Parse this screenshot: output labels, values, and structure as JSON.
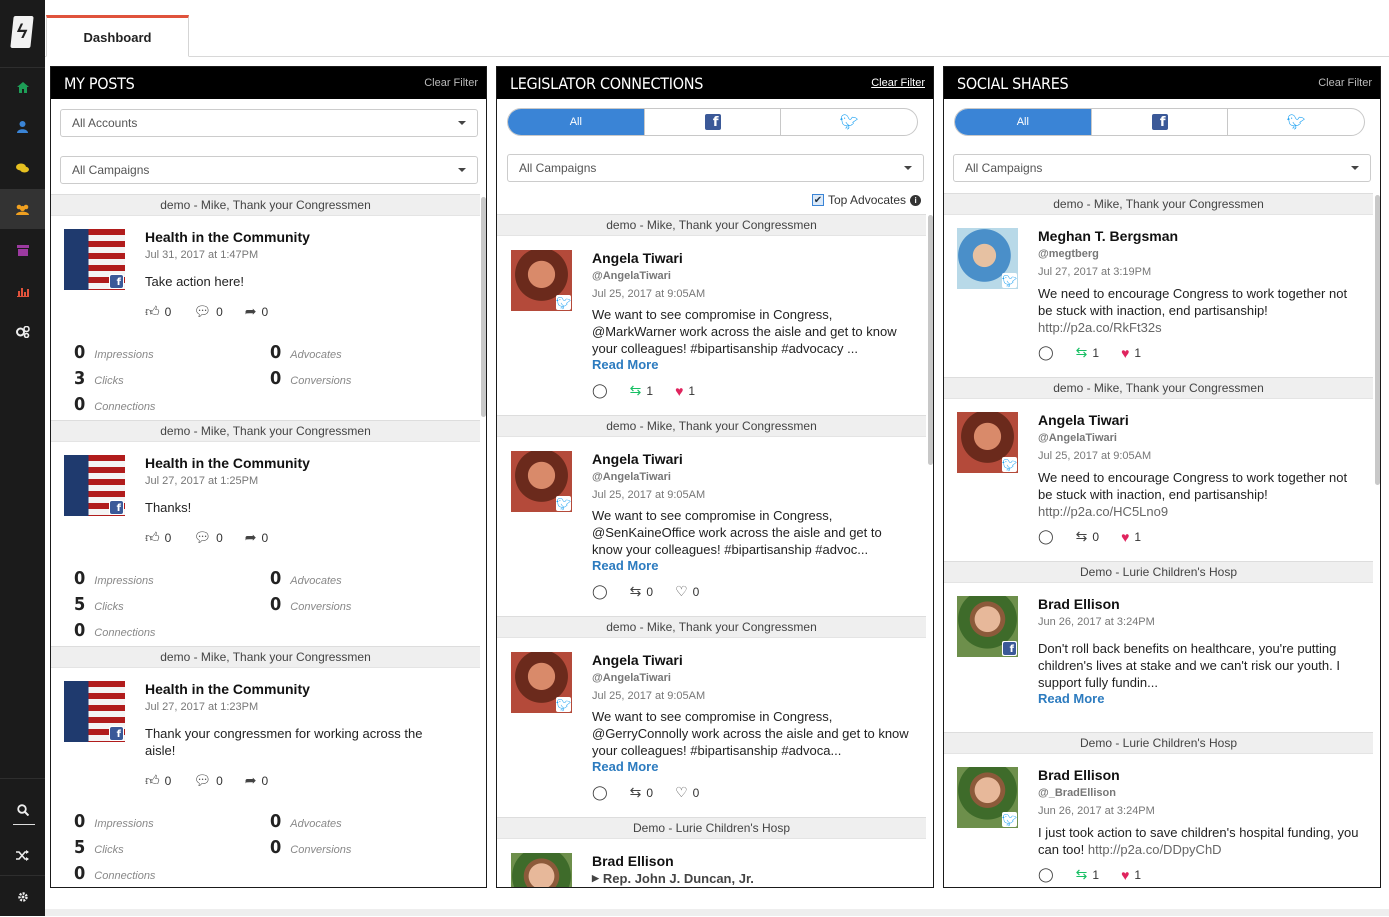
{
  "nav": {
    "icons": [
      "home-icon",
      "user-icon",
      "chat-icon",
      "group-icon",
      "archive-icon",
      "chart-icon",
      "settings-icon"
    ],
    "bottom_icons": [
      "search-icon",
      "shuffle-icon",
      "gear-icon"
    ]
  },
  "tabs": [
    {
      "label": "Dashboard"
    }
  ],
  "colors": {
    "accent": "#3a84d6",
    "tab_accent": "#e0533c",
    "facebook": "#3b5998",
    "twitter": "#1da1f2",
    "heart": "#e0245e",
    "retweet": "#17bf63"
  },
  "my_posts": {
    "title": "MY POSTS",
    "clear_filter": "Clear Filter",
    "accounts_select": "All Accounts",
    "campaigns_select": "All Campaigns",
    "groups": [
      {
        "campaign": "demo - Mike, Thank your Congressmen",
        "title": "Health in the Community",
        "date": "Jul 31, 2017 at 1:47PM",
        "text": "Take action here!",
        "likes": "0",
        "comments": "0",
        "shares": "0",
        "impressions": "0",
        "impressions_label": "Impressions",
        "clicks": "3",
        "clicks_label": "Clicks",
        "connections": "0",
        "connections_label": "Connections",
        "advocates": "0",
        "advocates_label": "Advocates",
        "conversions": "0",
        "conversions_label": "Conversions"
      },
      {
        "campaign": "demo - Mike, Thank your Congressmen",
        "title": "Health in the Community",
        "date": "Jul 27, 2017 at 1:25PM",
        "text": "Thanks!",
        "likes": "0",
        "comments": "0",
        "shares": "0",
        "impressions": "0",
        "impressions_label": "Impressions",
        "clicks": "5",
        "clicks_label": "Clicks",
        "connections": "0",
        "connections_label": "Connections",
        "advocates": "0",
        "advocates_label": "Advocates",
        "conversions": "0",
        "conversions_label": "Conversions"
      },
      {
        "campaign": "demo - Mike, Thank your Congressmen",
        "title": "Health in the Community",
        "date": "Jul 27, 2017 at 1:23PM",
        "text": "Thank your congressmen for working across the aisle!",
        "likes": "0",
        "comments": "0",
        "shares": "0",
        "impressions": "0",
        "impressions_label": "Impressions",
        "clicks": "5",
        "clicks_label": "Clicks",
        "connections": "0",
        "connections_label": "Connections",
        "advocates": "0",
        "advocates_label": "Advocates",
        "conversions": "0",
        "conversions_label": "Conversions"
      }
    ]
  },
  "legislator": {
    "title": "LEGISLATOR CONNECTIONS",
    "clear_filter": "Clear Filter",
    "segment_all": "All",
    "campaigns_select": "All Campaigns",
    "top_advocates": "Top Advocates",
    "read_more": "Read More",
    "items": [
      {
        "campaign": "demo - Mike, Thank your Congressmen",
        "name": "Angela Tiwari",
        "handle": "@AngelaTiwari",
        "date": "Jul 25, 2017 at 9:05AM",
        "text": "We want to see compromise in Congress, @MarkWarner work across the aisle and get to know your colleagues! #bipartisanship #advocacy ...",
        "retweets": "1",
        "likes": "1"
      },
      {
        "campaign": "demo - Mike, Thank your Congressmen",
        "name": "Angela Tiwari",
        "handle": "@AngelaTiwari",
        "date": "Jul 25, 2017 at 9:05AM",
        "text": "We want to see compromise in Congress, @SenKaineOffice work across the aisle and get to know your colleagues! #bipartisanship #advoc...",
        "retweets": "0",
        "likes": "0"
      },
      {
        "campaign": "demo - Mike, Thank your Congressmen",
        "name": "Angela Tiwari",
        "handle": "@AngelaTiwari",
        "date": "Jul 25, 2017 at 9:05AM",
        "text": "We want to see compromise in Congress, @GerryConnolly work across the aisle and get to know your colleagues! #bipartisanship #advoca...",
        "retweets": "0",
        "likes": "0"
      }
    ],
    "last": {
      "campaign": "Demo - Lurie Children's Hosp",
      "name": "Brad Ellison",
      "rep": "Rep. John J. Duncan, Jr."
    }
  },
  "social": {
    "title": "SOCIAL SHARES",
    "clear_filter": "Clear Filter",
    "segment_all": "All",
    "campaigns_select": "All Campaigns",
    "read_more": "Read More",
    "items": [
      {
        "campaign": "demo - Mike, Thank your Congressmen",
        "name": "Meghan T. Bergsman",
        "handle": "@megtberg",
        "date": "Jul 27, 2017 at 3:19PM",
        "text": "We need to encourage Congress to work together not be stuck with inaction, end partisanship!",
        "link": "http://p2a.co/RkFt32s",
        "retweets": "1",
        "likes": "1"
      },
      {
        "campaign": "demo - Mike, Thank your Congressmen",
        "name": "Angela Tiwari",
        "handle": "@AngelaTiwari",
        "date": "Jul 25, 2017 at 9:05AM",
        "text": "We need to encourage Congress to work together not be stuck with inaction, end partisanship!",
        "link": "http://p2a.co/HC5Lno9",
        "retweets": "0",
        "likes": "1"
      },
      {
        "campaign": "Demo - Lurie Children's Hosp",
        "name": "Brad Ellison",
        "date": "Jun 26, 2017 at 3:24PM",
        "text": "Don't roll back benefits on healthcare, you're putting children's lives at stake and we can't risk our youth. I support fully fundin..."
      },
      {
        "campaign": "Demo - Lurie Children's Hosp",
        "name": "Brad Ellison",
        "handle": "@_BradEllison",
        "date": "Jun 26, 2017 at 3:24PM",
        "text": "I just took action to save children's hospital funding, you can too!",
        "link": "http://p2a.co/DDpyChD",
        "retweets": "1",
        "likes": "1"
      }
    ]
  }
}
